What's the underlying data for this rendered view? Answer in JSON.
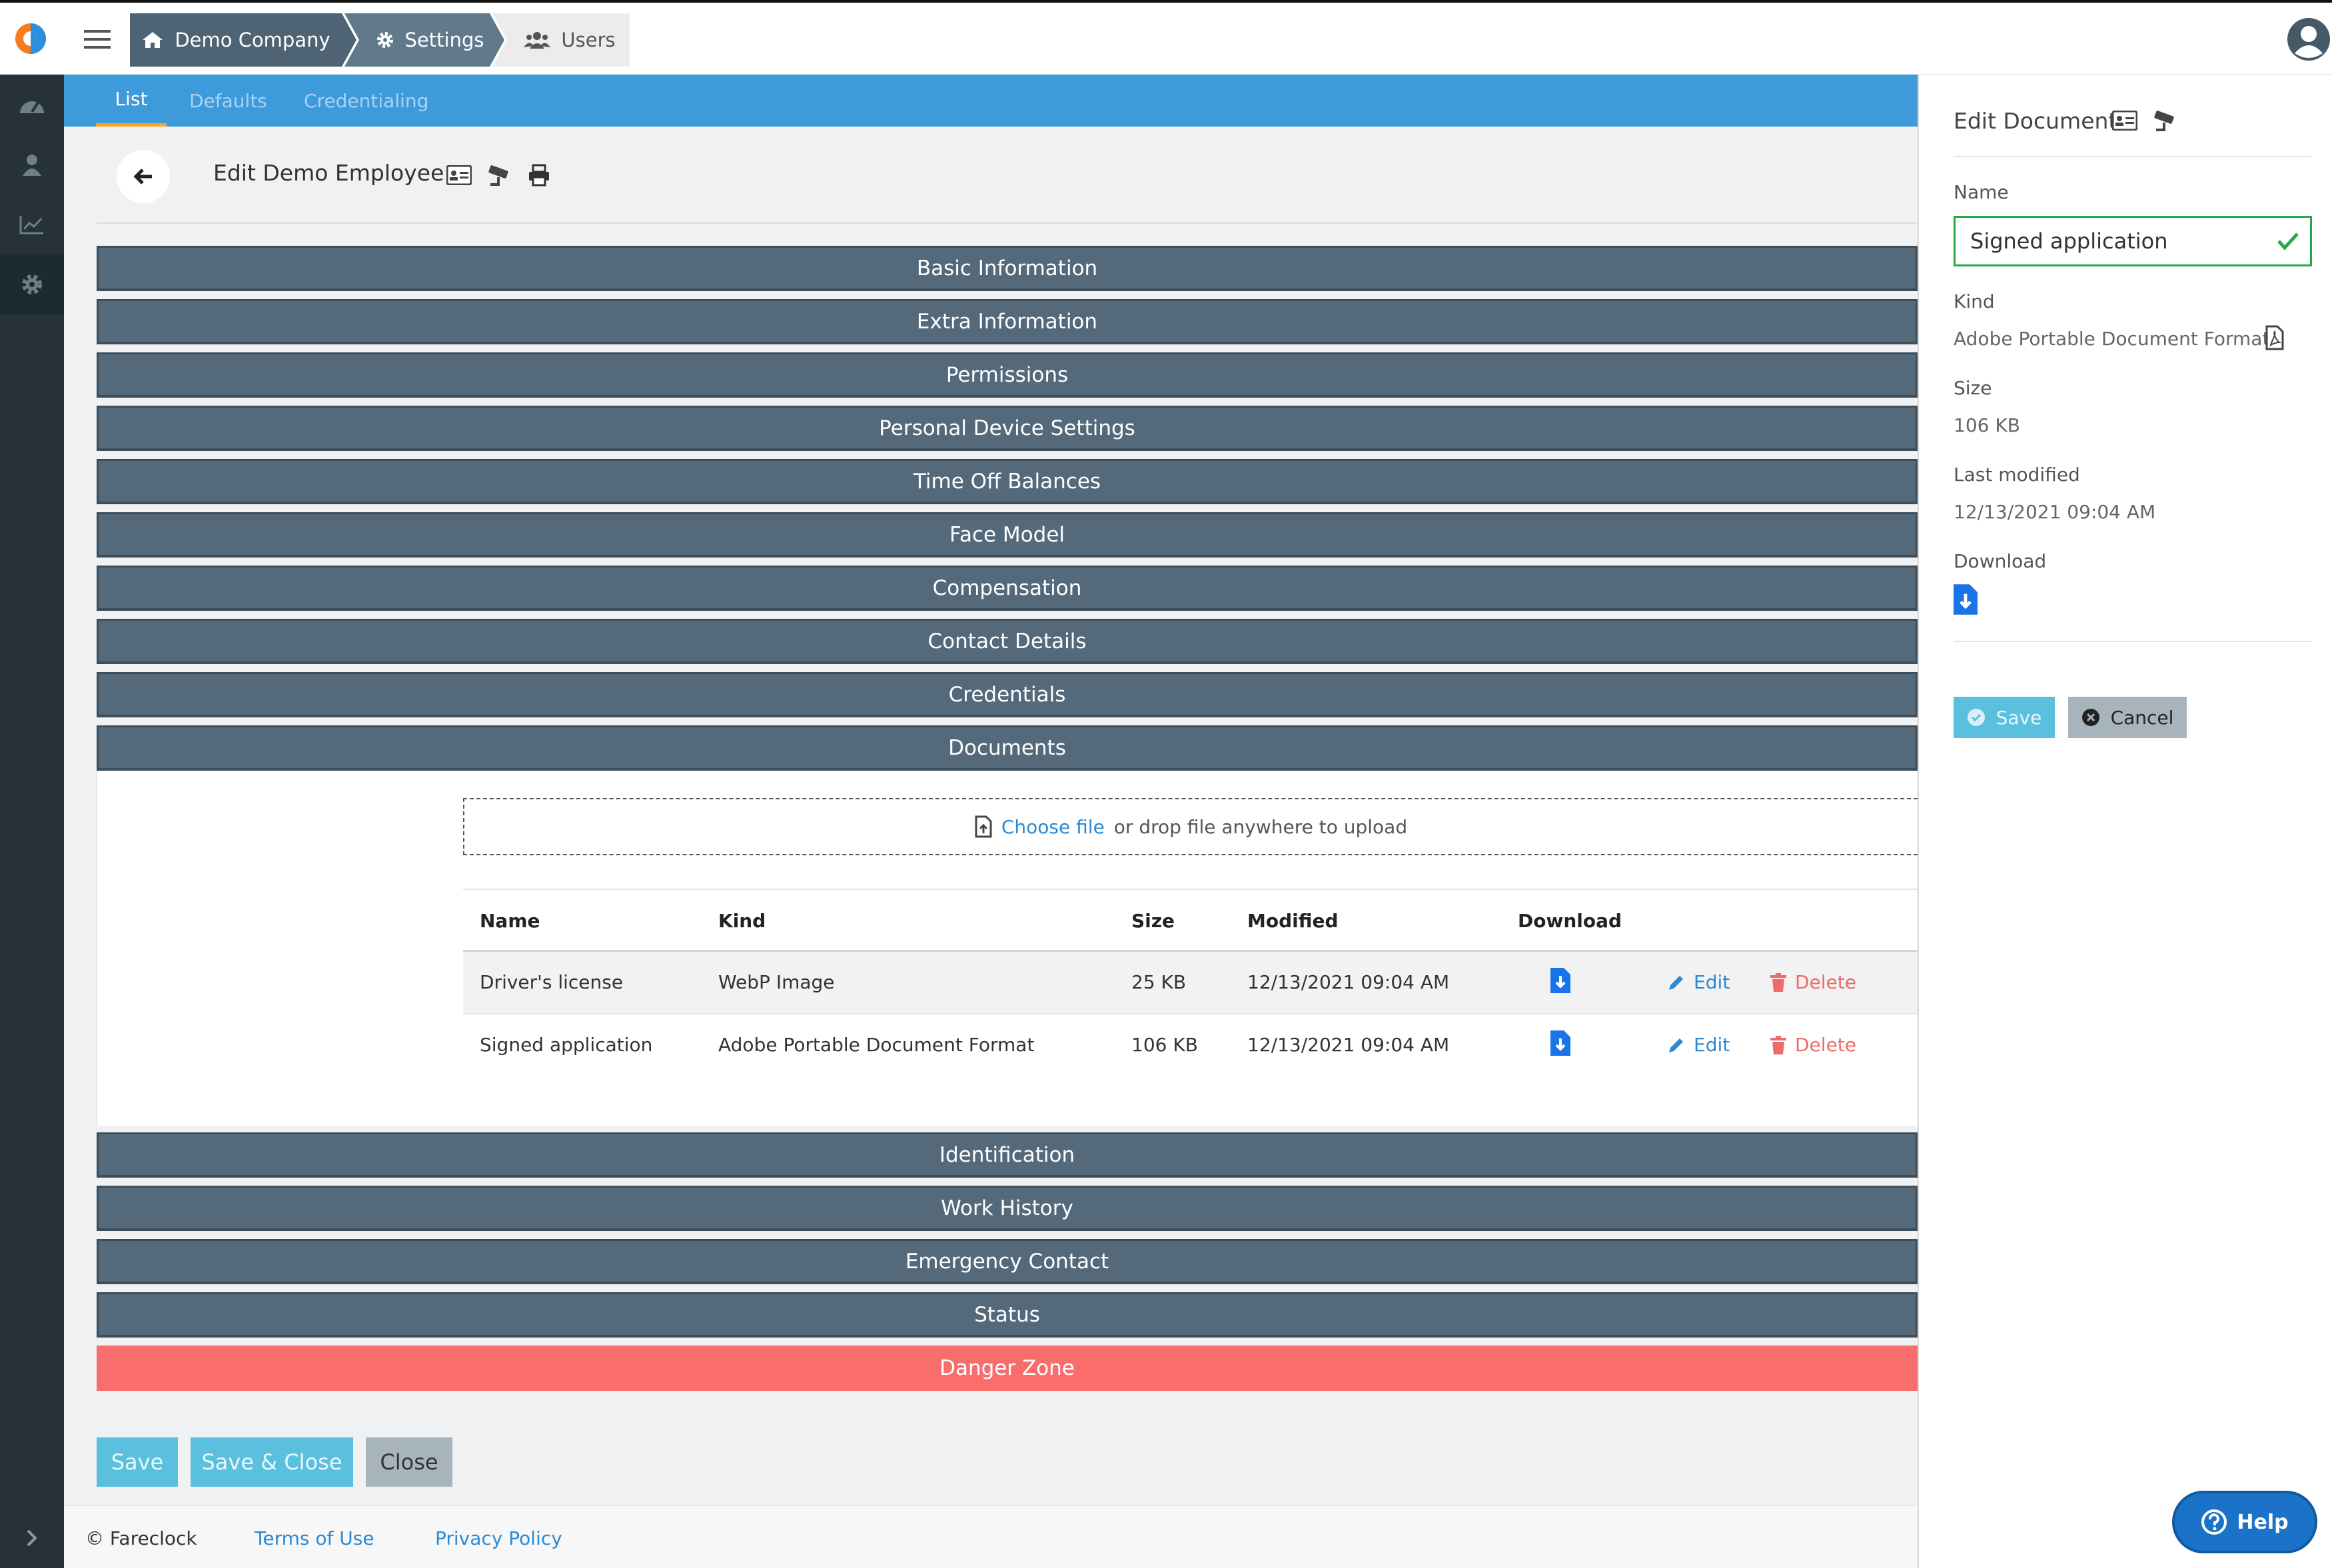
{
  "breadcrumb": [
    "Demo Company",
    "Settings",
    "Users"
  ],
  "icons": {
    "logo": "app-logo",
    "menu": "hamburger-menu-icon",
    "home": "home-icon",
    "settings": "gear-icon",
    "users": "users-icon",
    "user": "user-circle-icon"
  },
  "tabs": {
    "list": "List",
    "defaults": "Defaults",
    "credentialing": "Credentialing"
  },
  "page_title": "Edit Demo Employee",
  "sections": {
    "before": [
      "Basic Information",
      "Extra Information",
      "Permissions",
      "Personal Device Settings",
      "Time Off Balances",
      "Face Model",
      "Compensation",
      "Contact Details",
      "Credentials",
      "Documents"
    ],
    "after": [
      "Identification",
      "Work History",
      "Emergency Contact",
      "Status"
    ],
    "danger": "Danger Zone"
  },
  "upload": {
    "choose": "Choose file",
    "rest": "or drop file anywhere to upload"
  },
  "documents": {
    "headers": [
      "Name",
      "Kind",
      "Size",
      "Modified",
      "Download"
    ],
    "rows": [
      {
        "name": "Driver's license",
        "kind": "WebP Image",
        "size": "25 KB",
        "modified": "12/13/2021 09:04 AM"
      },
      {
        "name": "Signed application",
        "kind": "Adobe Portable Document Format",
        "size": "106 KB",
        "modified": "12/13/2021 09:04 AM"
      }
    ],
    "edit": "Edit",
    "delete": "Delete"
  },
  "actions": {
    "save": "Save",
    "save_close": "Save & Close",
    "close": "Close"
  },
  "footer": {
    "copyright": "© Fareclock",
    "terms": "Terms of Use",
    "privacy": "Privacy Policy"
  },
  "panel": {
    "title": "Edit Document",
    "name_label": "Name",
    "name_value": "Signed application",
    "kind_label": "Kind",
    "kind_value": "Adobe Portable Document Format",
    "size_label": "Size",
    "size_value": "106 KB",
    "modified_label": "Last modified",
    "modified_value": "12/13/2021 09:04 AM",
    "download_label": "Download",
    "save": "Save",
    "cancel": "Cancel"
  },
  "help": "Help",
  "colors": {
    "accent": "#3d9bdc",
    "section": "#546a7b",
    "danger": "#f96d6c",
    "link": "#2a8ad4",
    "delete": "#ef6b6b",
    "success": "#28a745"
  }
}
